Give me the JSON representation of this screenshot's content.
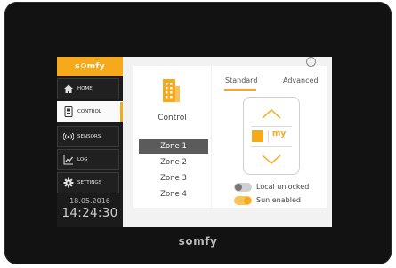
{
  "brand": {
    "pre": "s",
    "post": "mfy"
  },
  "sidebar": {
    "items": [
      {
        "label": "HOME",
        "icon": "home-icon"
      },
      {
        "label": "CONTROL",
        "icon": "remote-icon",
        "active": true
      },
      {
        "label": "SENSORS",
        "icon": "sensor-icon"
      },
      {
        "label": "LOG",
        "icon": "chart-icon"
      },
      {
        "label": "SETTINGS",
        "icon": "gear-icon"
      }
    ],
    "date": "18.05.2016",
    "time": "14:24:30"
  },
  "control": {
    "label": "Control",
    "icon": "building-icon"
  },
  "zones": [
    "Zone 1",
    "Zone 2",
    "Zone 3",
    "Zone 4"
  ],
  "selected_zone": "Zone 1",
  "tabs": {
    "standard": "Standard",
    "advanced": "Advanced",
    "active": "Standard"
  },
  "remote": {
    "my_label": "my"
  },
  "toggles": {
    "local_unlocked": {
      "label": "Local unlocked",
      "on": false
    },
    "sun_enabled": {
      "label": "Sun enabled",
      "on": true
    }
  },
  "info_glyph": "i",
  "colors": {
    "accent": "#f7a91c",
    "sidebar": "#1b1b1b",
    "bezel": "#121212"
  },
  "footer_logo": {
    "pre": "s",
    "post": "mfy"
  }
}
